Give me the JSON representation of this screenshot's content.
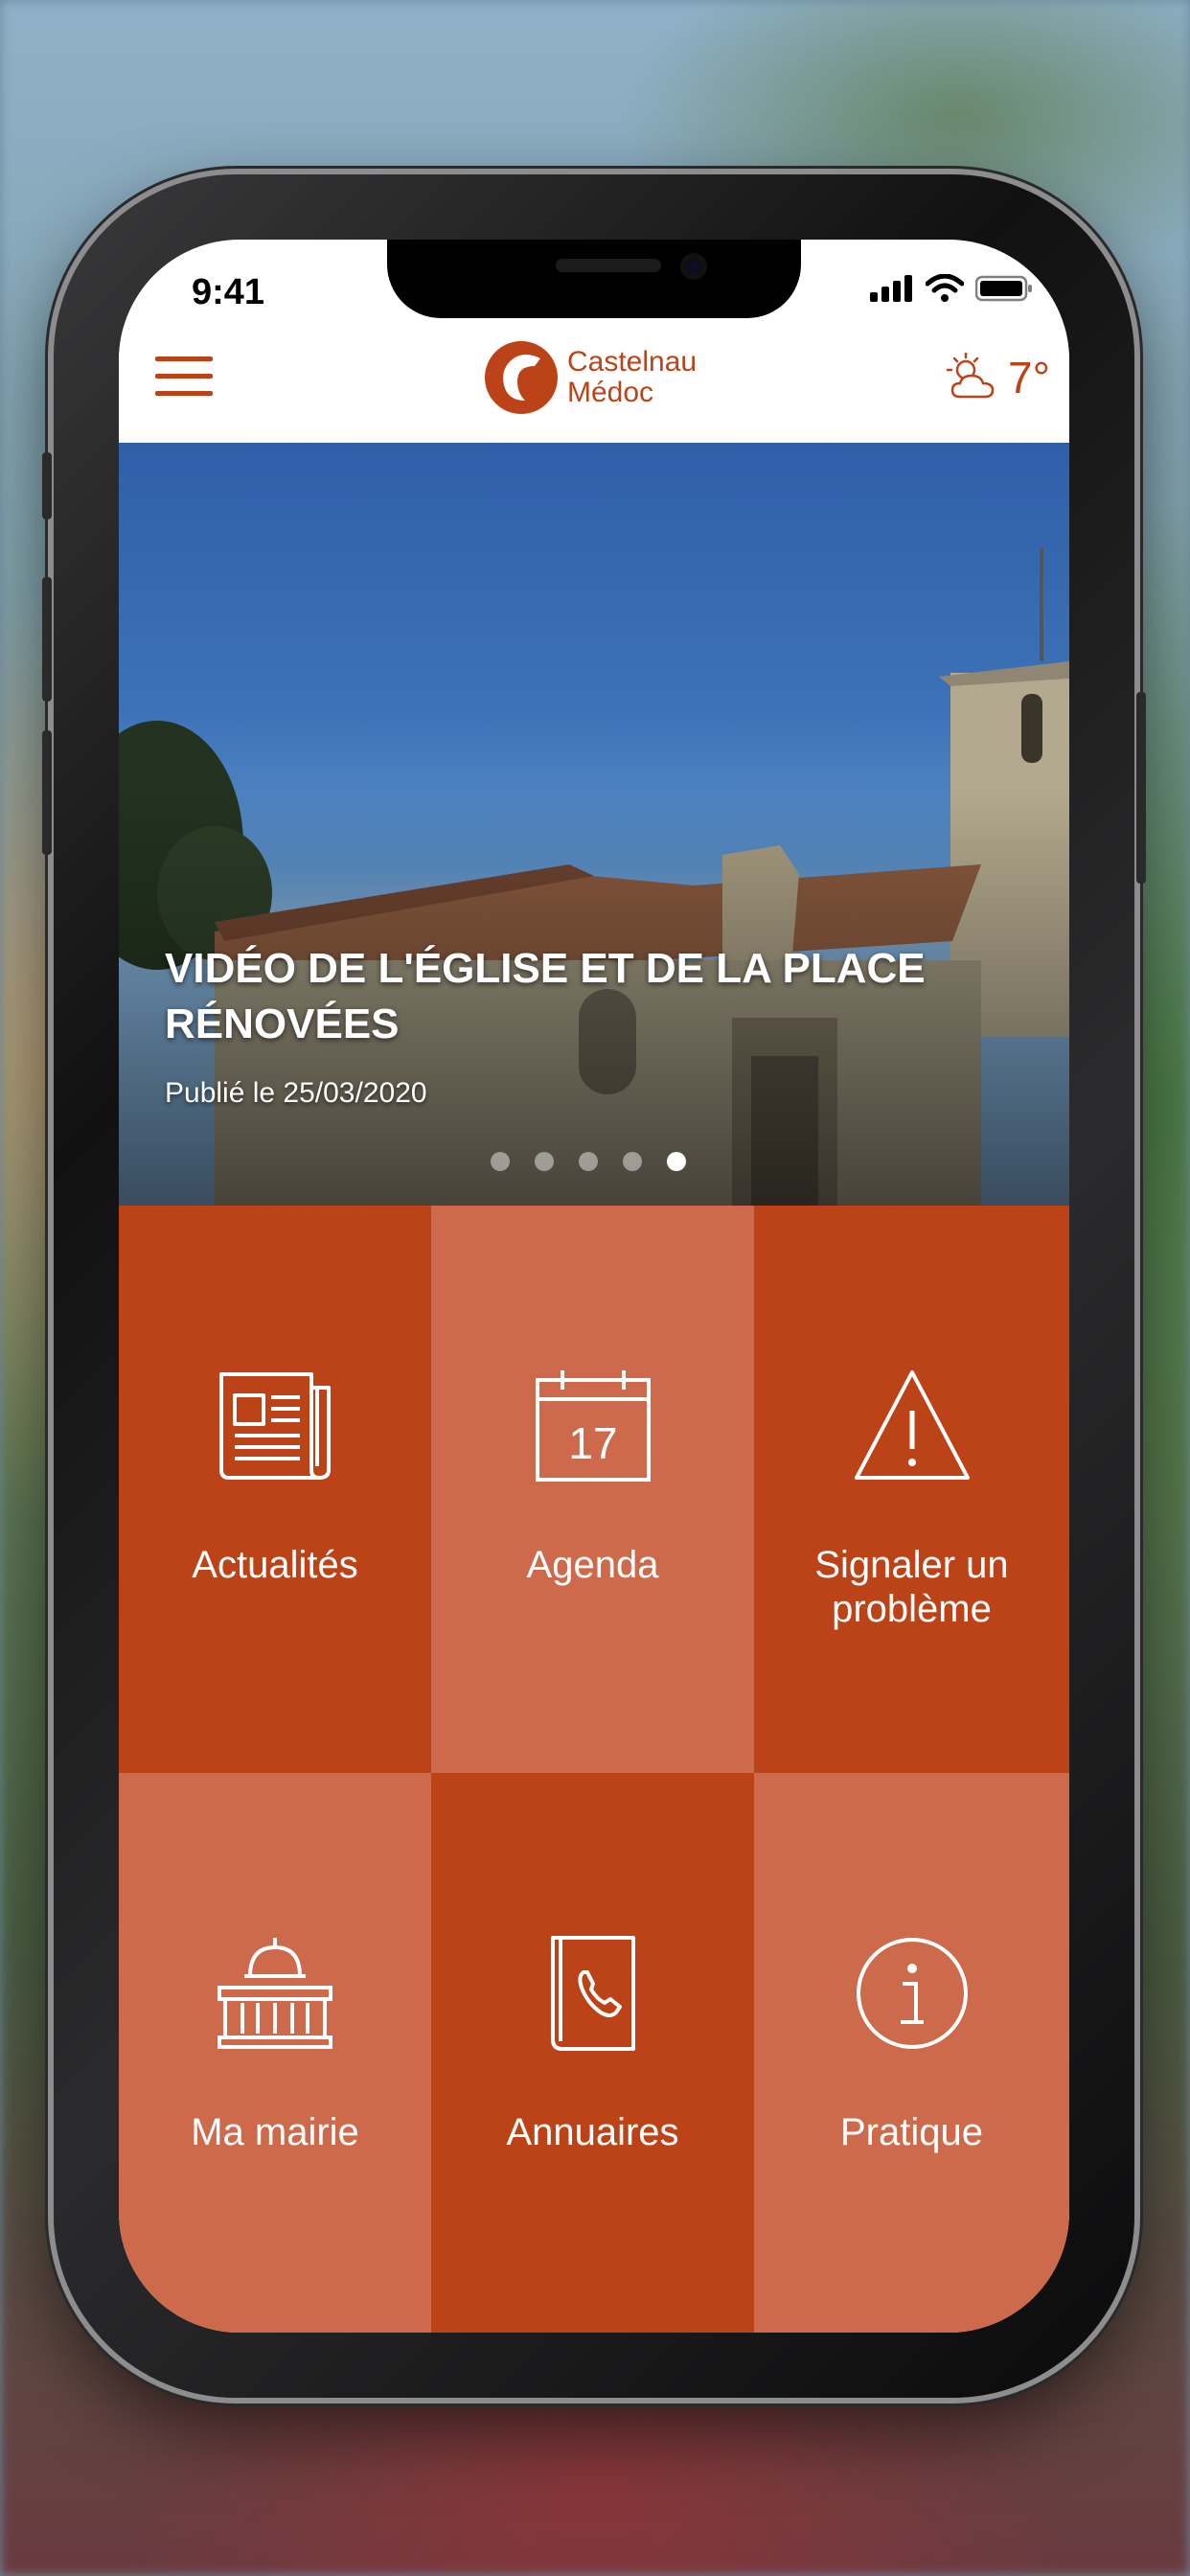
{
  "status_bar": {
    "time": "9:41"
  },
  "header": {
    "logo_line1": "Castelnau",
    "logo_line2": "Médoc",
    "temperature": "7°",
    "weather_icon": "partly-cloudy-icon"
  },
  "hero": {
    "title": "VIDÉO DE L'ÉGLISE ET DE LA PLACE RÉNOVÉES",
    "date": "Publié le 25/03/2020",
    "slides": 5,
    "active_slide": 5
  },
  "tiles": [
    {
      "label": "Actualités",
      "icon": "newspaper-icon"
    },
    {
      "label": "Agenda",
      "icon": "calendar-icon",
      "calendar_day": "17"
    },
    {
      "label": "Signaler un problème",
      "icon": "warning-icon"
    },
    {
      "label": "Ma mairie",
      "icon": "town-hall-icon"
    },
    {
      "label": "Annuaires",
      "icon": "phone-book-icon"
    },
    {
      "label": "Pratique",
      "icon": "info-icon"
    }
  ],
  "colors": {
    "accent": "#bc4318",
    "tile_light": "#cc6a4b"
  }
}
